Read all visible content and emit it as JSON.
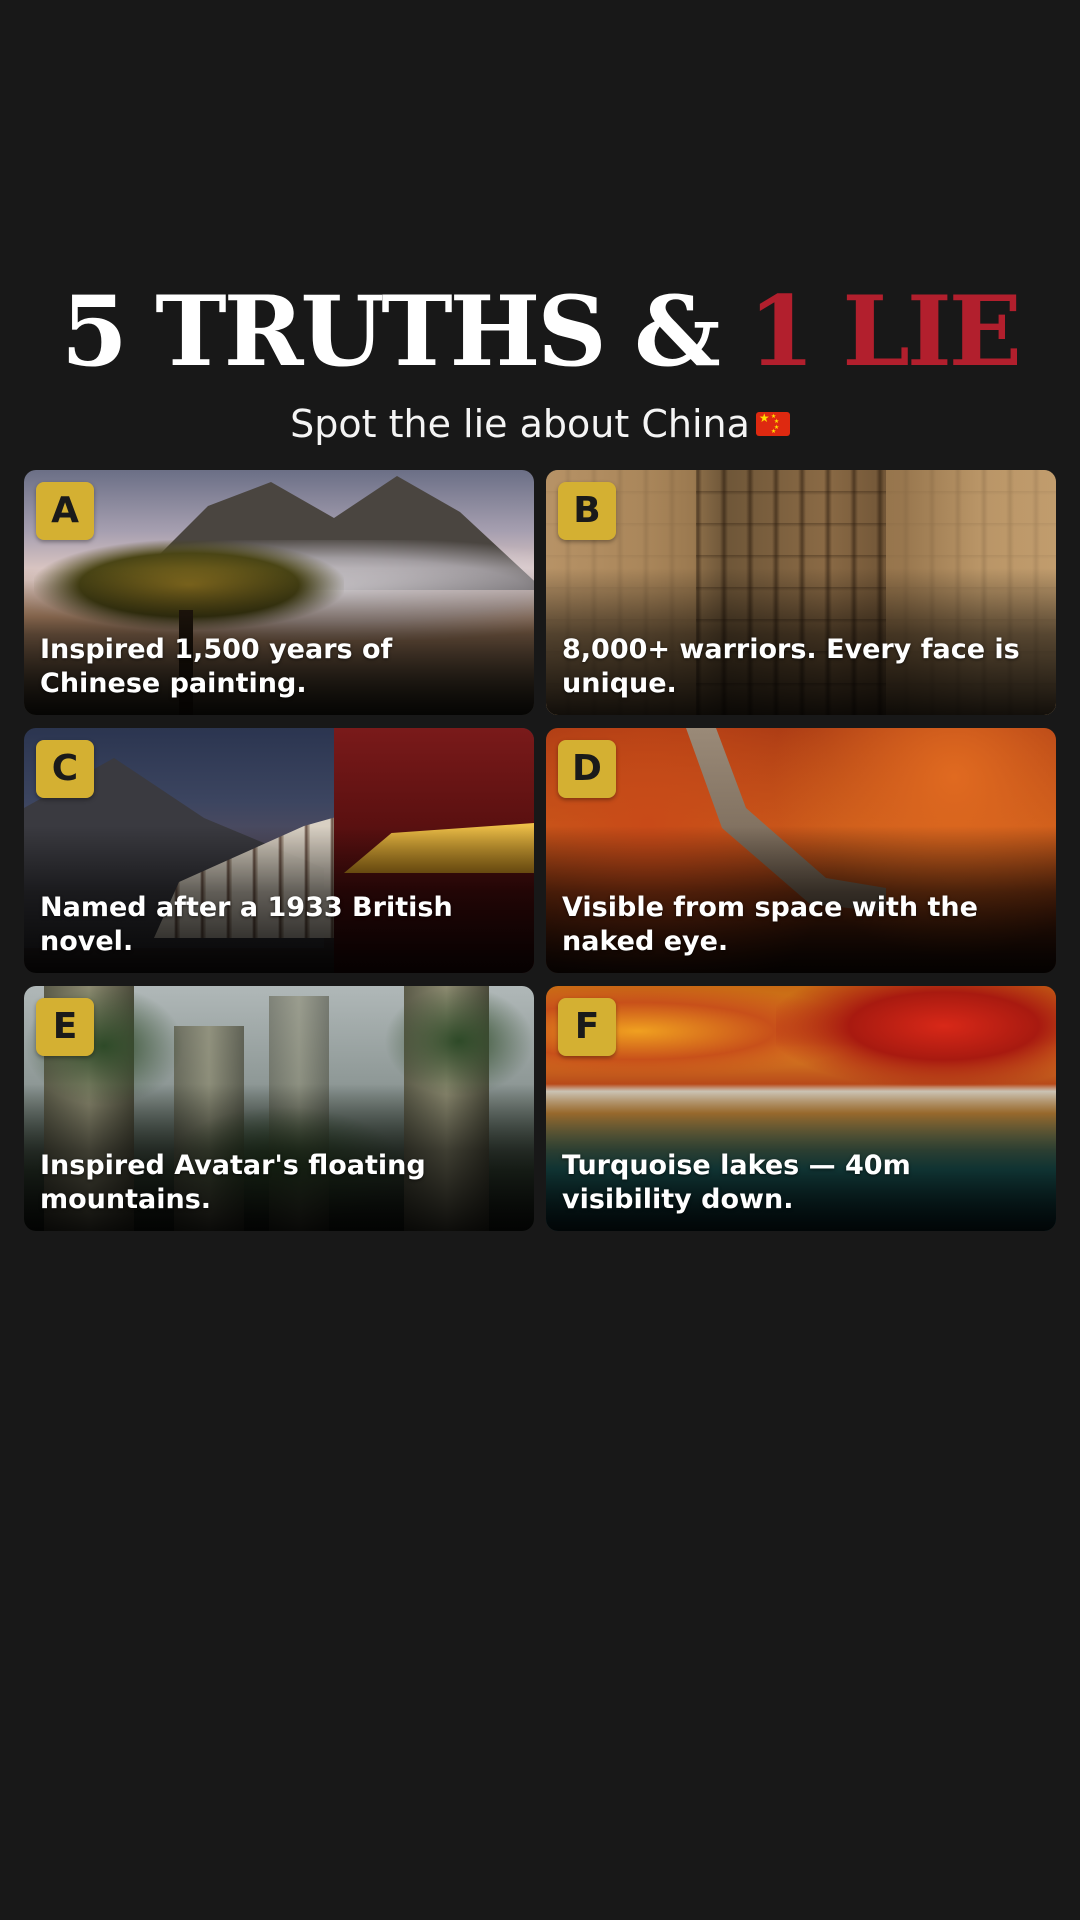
{
  "header": {
    "title_main": "5 TRUTHS & ",
    "title_accent": "1 LIE",
    "subtitle": "Spot the lie about China"
  },
  "cards": [
    {
      "letter": "A",
      "caption": "Inspired 1,500 years of Chinese painting."
    },
    {
      "letter": "B",
      "caption": "8,000+ warriors. Every face is unique."
    },
    {
      "letter": "C",
      "caption": "Named after a 1933 British novel."
    },
    {
      "letter": "D",
      "caption": "Visible from space with the naked eye."
    },
    {
      "letter": "E",
      "caption": "Inspired Avatar's floating mountains."
    },
    {
      "letter": "F",
      "caption": "Turquoise lakes — 40m visibility down."
    }
  ],
  "icons": {
    "flag": "china-flag-icon"
  },
  "colors": {
    "background": "#181818",
    "accent_red": "#b21f2d",
    "badge_gold": "#d4b032"
  }
}
